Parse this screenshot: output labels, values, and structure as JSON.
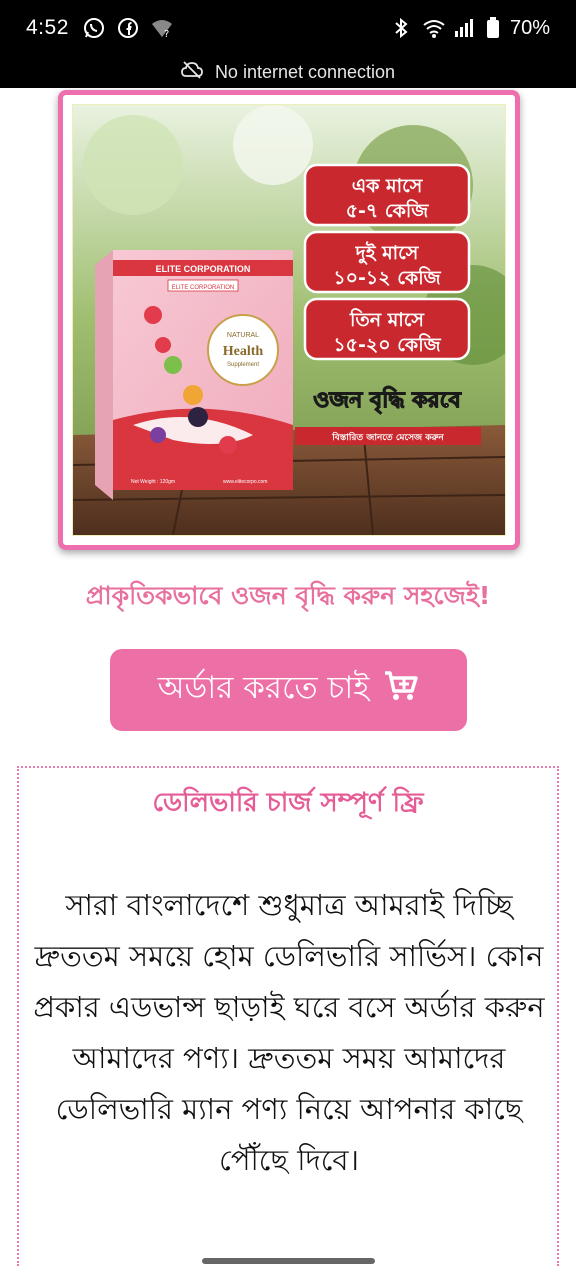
{
  "status_bar": {
    "time": "4:52",
    "battery": "70%",
    "icons_left": [
      "whatsapp-icon",
      "facebook-icon",
      "wifi-question-icon"
    ],
    "icons_right": [
      "bluetooth-icon",
      "wifi-icon",
      "signal-icon",
      "signal-icon",
      "battery-icon"
    ]
  },
  "network_banner": {
    "text": "No internet connection",
    "icon": "cloud-off-icon"
  },
  "hero": {
    "badges": [
      "এক মাসে\n৫-৭ কেজি",
      "দুই মাসে\n১০-১২ কেজি",
      "তিন মাসে\n১৫-২০ কেজি"
    ],
    "badge_line1": [
      "এক মাসে",
      "দুই মাসে",
      "তিন মাসে"
    ],
    "badge_line2": [
      "৫-৭ কেজি",
      "১০-১২ কেজি",
      "১৫-২০ কেজি"
    ],
    "headline": "ওজন বৃদ্ধি করবে",
    "sub_banner": "বিস্তারিত জানতে মেসেজ করুন",
    "product_brand": "ELITE CORPORATION",
    "product_brand_small": "ELITE CORPORATION",
    "product_natural": "NATURAL",
    "product_health": "Health",
    "product_supplement": "Supplement",
    "product_weight": "Net Weight : 120gm",
    "product_site": "www.elitecorpo.com"
  },
  "tagline": "প্রাকৃতিকভাবে ওজন বৃদ্ধি করুন সহজেই!",
  "order_button": {
    "label": "অর্ডার করতে চাই",
    "icon": "cart-plus-icon"
  },
  "delivery": {
    "title": "ডেলিভারি চার্জ সম্পূর্ণ ফ্রি",
    "body": "সারা বাংলাদেশে শুধুমাত্র আমরাই দিচ্ছি দ্রুততম সময়ে হোম ডেলিভারি সার্ভিস। কোন প্রকার এডভান্স ছাড়াই ঘরে বসে অর্ডার করুন আমাদের পণ্য। দ্রুততম সময় আমাদের ডেলিভারি ম্যান পণ্য নিয়ে আপনার কাছে পৌঁছে দিবে।"
  },
  "colors": {
    "accent": "#ec6fa6",
    "tagline": "#e8709e",
    "badge_red": "#c9282e",
    "status_bar": "#000000"
  }
}
